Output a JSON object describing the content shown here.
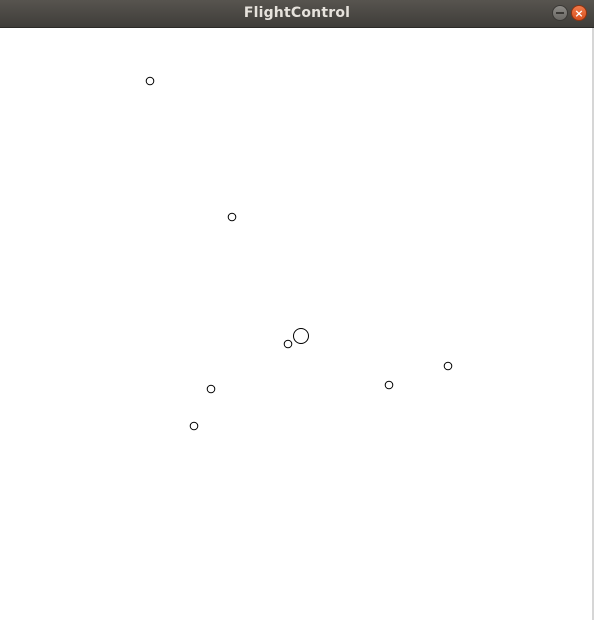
{
  "window": {
    "title": "FlightControl",
    "controls": {
      "minimize_icon": "minimize-icon",
      "close_icon": "close-icon",
      "close_glyph": "×",
      "close_color": "#e95420"
    }
  },
  "canvas": {
    "background": "#ffffff",
    "stroke_color": "#000000"
  }
}
